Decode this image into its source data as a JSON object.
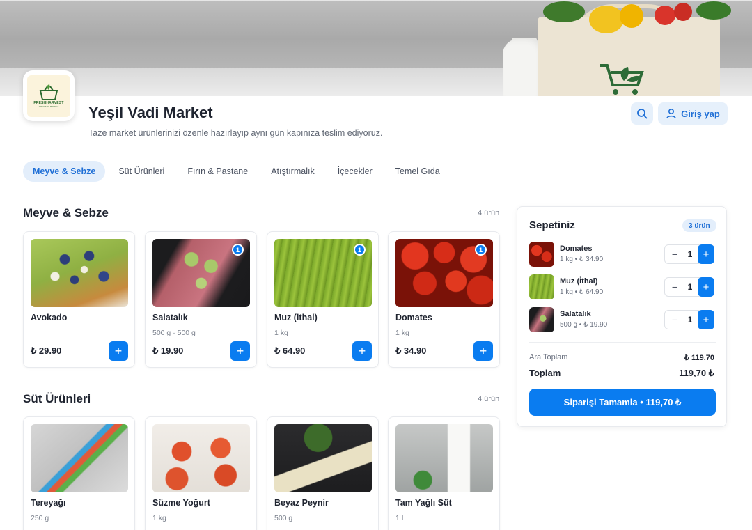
{
  "store": {
    "name": "Yeşil Vadi Market",
    "description": "Taze market ürünlerinizi özenle hazırlayıp aynı gün kapınıza teslim ediyoruz.",
    "logo_text": "FRESHHARVEST",
    "logo_subtext": "GROCERY MARKET"
  },
  "header": {
    "login_label": "Giriş yap"
  },
  "tabs": [
    {
      "label": "Meyve & Sebze",
      "active": true
    },
    {
      "label": "Süt Ürünleri",
      "active": false
    },
    {
      "label": "Fırın & Pastane",
      "active": false
    },
    {
      "label": "Atıştırmalık",
      "active": false
    },
    {
      "label": "İçecekler",
      "active": false
    },
    {
      "label": "Temel Gıda",
      "active": false
    }
  ],
  "sections": [
    {
      "title": "Meyve & Sebze",
      "count": "4 ürün",
      "products": [
        {
          "name": "Avokado",
          "unit": "",
          "price": "₺ 29.90",
          "badge": ""
        },
        {
          "name": "Salatalık",
          "unit": "500 g · 500 g",
          "price": "₺ 19.90",
          "badge": "1"
        },
        {
          "name": "Muz (İthal)",
          "unit": "1 kg",
          "price": "₺ 64.90",
          "badge": "1"
        },
        {
          "name": "Domates",
          "unit": "1 kg",
          "price": "₺ 34.90",
          "badge": "1"
        }
      ]
    },
    {
      "title": "Süt Ürünleri",
      "count": "4 ürün",
      "products": [
        {
          "name": "Tereyağı",
          "unit": "250 g",
          "price": "",
          "badge": ""
        },
        {
          "name": "Süzme Yoğurt",
          "unit": "1 kg",
          "price": "",
          "badge": ""
        },
        {
          "name": "Beyaz Peynir",
          "unit": "500 g",
          "price": "",
          "badge": ""
        },
        {
          "name": "Tam Yağlı Süt",
          "unit": "1 L",
          "price": "",
          "badge": ""
        }
      ]
    }
  ],
  "cart": {
    "title": "Sepetiniz",
    "count": "3 ürün",
    "items": [
      {
        "name": "Domates",
        "detail": "1 kg • ₺ 34.90",
        "qty": "1"
      },
      {
        "name": "Muz (İthal)",
        "detail": "1 kg • ₺ 64.90",
        "qty": "1"
      },
      {
        "name": "Salatalık",
        "detail": "500 g • ₺ 19.90",
        "qty": "1"
      }
    ],
    "subtotal_label": "Ara Toplam",
    "subtotal_value": "₺ 119.70",
    "total_label": "Toplam",
    "total_value": "119,70 ₺",
    "checkout_label": "Siparişi Tamamla • 119,70 ₺"
  },
  "colors": {
    "accent": "#0a7cf0",
    "accent_soft": "#e3eefb"
  }
}
